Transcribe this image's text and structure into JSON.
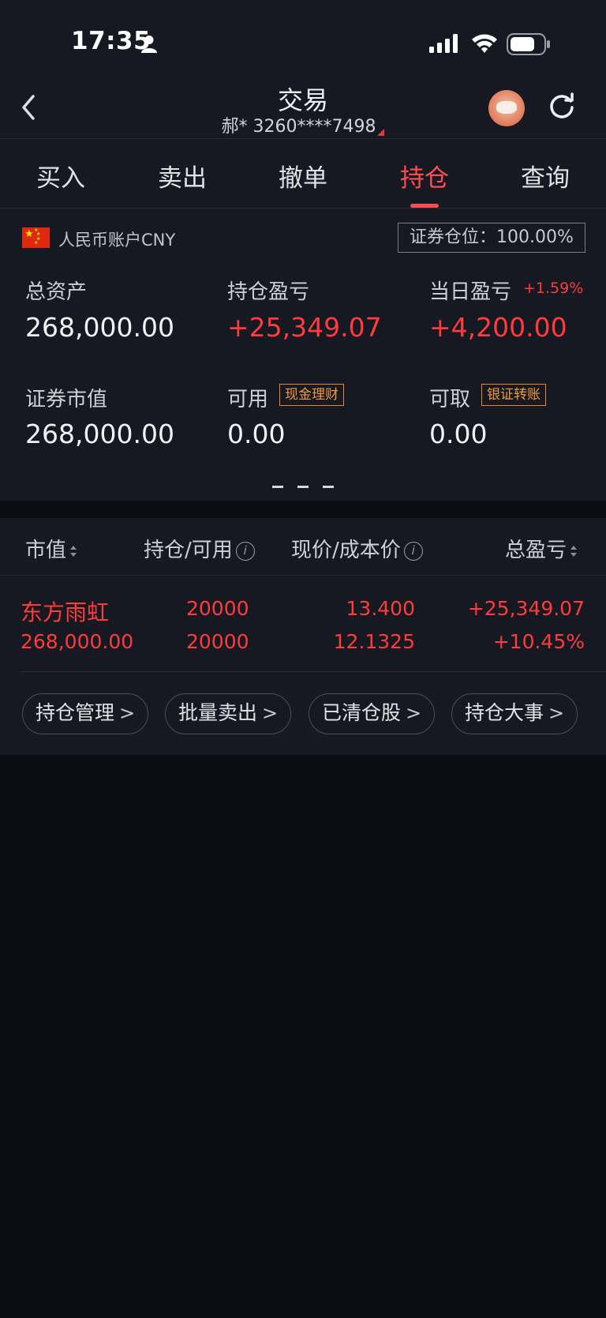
{
  "status_bar": {
    "time": "17:35"
  },
  "header": {
    "title": "交易",
    "account": "郝* 3260****7498"
  },
  "tabs": [
    {
      "label": "买入"
    },
    {
      "label": "卖出"
    },
    {
      "label": "撤单"
    },
    {
      "label": "持仓",
      "active": true
    },
    {
      "label": "查询"
    }
  ],
  "account": {
    "currency_label": "人民币账户CNY",
    "position_ratio": "证券仓位：100.00%"
  },
  "summary": {
    "total_assets_label": "总资产",
    "total_assets": "268,000.00",
    "holding_pl_label": "持仓盈亏",
    "holding_pl": "+25,349.07",
    "daily_pl_label": "当日盈亏",
    "daily_pl_pct": "+1.59%",
    "daily_pl": "+4,200.00",
    "market_value_label": "证券市值",
    "market_value": "268,000.00",
    "available_label": "可用",
    "available_tag": "现金理财",
    "available": "0.00",
    "withdrawable_label": "可取",
    "withdrawable_tag": "银证转账",
    "withdrawable": "0.00"
  },
  "table": {
    "headers": {
      "market_value": "市值",
      "holding_available": "持仓/可用",
      "price_cost": "现价/成本价",
      "total_pl": "总盈亏"
    },
    "rows": [
      {
        "name": "东方雨虹",
        "market_value": "268,000.00",
        "holding": "20000",
        "available": "20000",
        "price": "13.400",
        "cost": "12.1325",
        "total_pl": "+25,349.07",
        "total_pl_pct": "+10.45%"
      }
    ]
  },
  "actions": [
    {
      "label": "持仓管理"
    },
    {
      "label": "批量卖出"
    },
    {
      "label": "已清仓股"
    },
    {
      "label": "持仓大事"
    }
  ],
  "colors": {
    "accent_red": "#ff4d4f",
    "tag_orange": "#f09a3a",
    "background": "#0b0c14",
    "panel": "#161922"
  }
}
